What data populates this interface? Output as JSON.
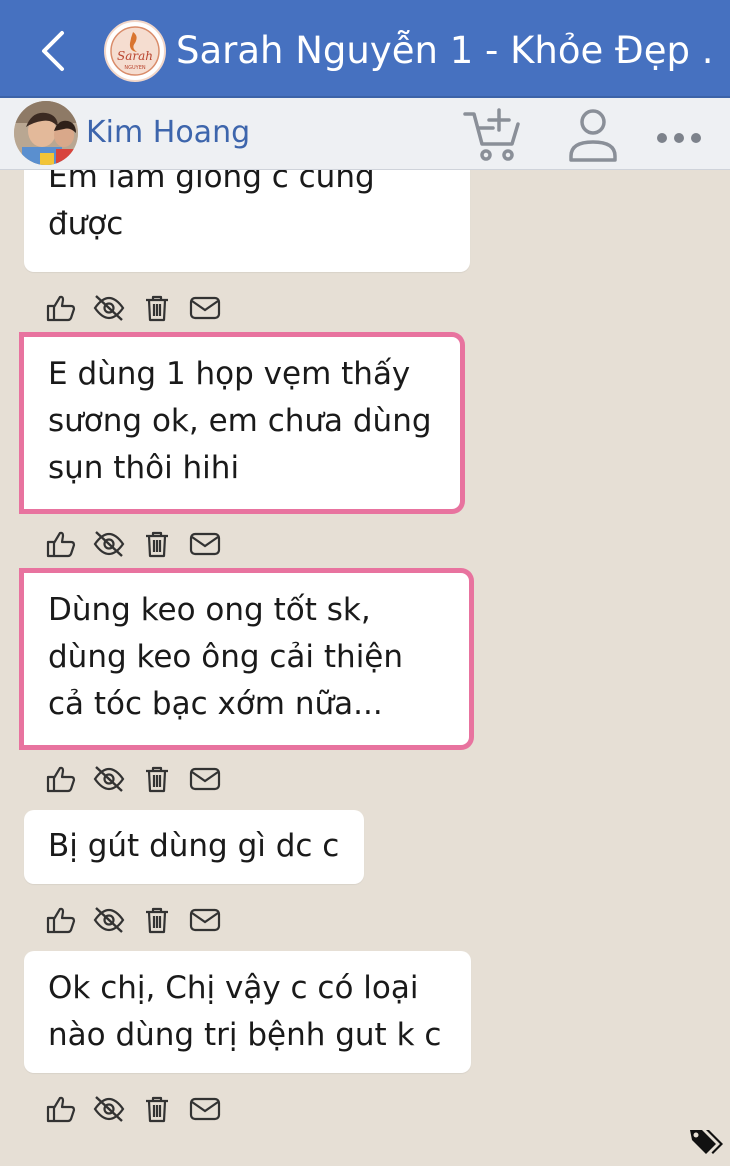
{
  "header": {
    "title": "Sarah Nguyễn 1 - Khỏe Đẹp ...",
    "logo_text_top": "Sarah",
    "logo_text_bottom": "NGUYEN"
  },
  "user": {
    "name": "Kim Hoang"
  },
  "messages": [
    {
      "text": "Em làm giống c cũng được"
    },
    {
      "text": "E dùng 1 họp vẹm thấy sương ok, em chưa dùng sụn thôi hihi"
    },
    {
      "text": "Dùng keo ong tốt sk, dùng keo ông cải thiện cả tóc bạc xớm nữa..."
    },
    {
      "text": "Bị gút dùng gì dc c"
    },
    {
      "text": "Ok chị, Chị vậy c có loại nào dùng trị bệnh gut k c"
    }
  ],
  "colors": {
    "header_bg": "#4671c0",
    "user_name": "#3d65ac",
    "highlight_border": "#e8739f",
    "feed_bg": "#e6dfd5"
  },
  "icons": {
    "back": "chevron-left-icon",
    "cart": "cart-plus-icon",
    "profile": "user-icon",
    "more": "more-horizontal-icon",
    "like": "thumbs-up-icon",
    "hide": "eye-off-icon",
    "delete": "trash-icon",
    "message": "envelope-icon",
    "tag": "tag-icon"
  }
}
